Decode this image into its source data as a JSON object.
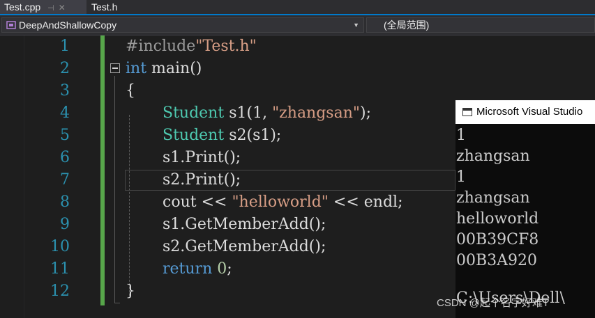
{
  "tabs": [
    {
      "label": "Test.cpp",
      "active": true,
      "pin": "⊣",
      "close": "✕"
    },
    {
      "label": "Test.h",
      "active": false
    }
  ],
  "nav": {
    "class_combo": "DeepAndShallowCopy",
    "scope_combo": "(全局范围)"
  },
  "line_numbers": [
    "1",
    "2",
    "3",
    "4",
    "5",
    "6",
    "7",
    "8",
    "9",
    "10",
    "11",
    "12"
  ],
  "code": {
    "l1_pp": "#include",
    "l1_str": "\"Test.h\"",
    "l2_kw": "int",
    "l2_rest": " main()",
    "l3": "{",
    "l4_type": "Student",
    "l4_a": " s1(1, ",
    "l4_str": "\"zhangsan\"",
    "l4_b": ");",
    "l5_type": "Student",
    "l5_rest": " s2(s1);",
    "l6": "s1.Print();",
    "l7": "s2.Print();",
    "l8_a": "cout << ",
    "l8_str": "\"helloworld\"",
    "l8_b": " << endl;",
    "l9": "s1.GetMemberAdd();",
    "l10": "s2.GetMemberAdd();",
    "l11_kw": "return",
    "l11_num": " 0",
    "l11_end": ";",
    "l12": "}"
  },
  "console": {
    "title": "Microsoft Visual Studio",
    "lines": [
      "1",
      "zhangsan",
      "1",
      "zhangsan",
      "helloworld",
      "00B39CF8",
      "00B3A920"
    ],
    "partial": "C:\\Users\\Dell\\"
  },
  "watermark": "CSDN @起个名字好难T"
}
